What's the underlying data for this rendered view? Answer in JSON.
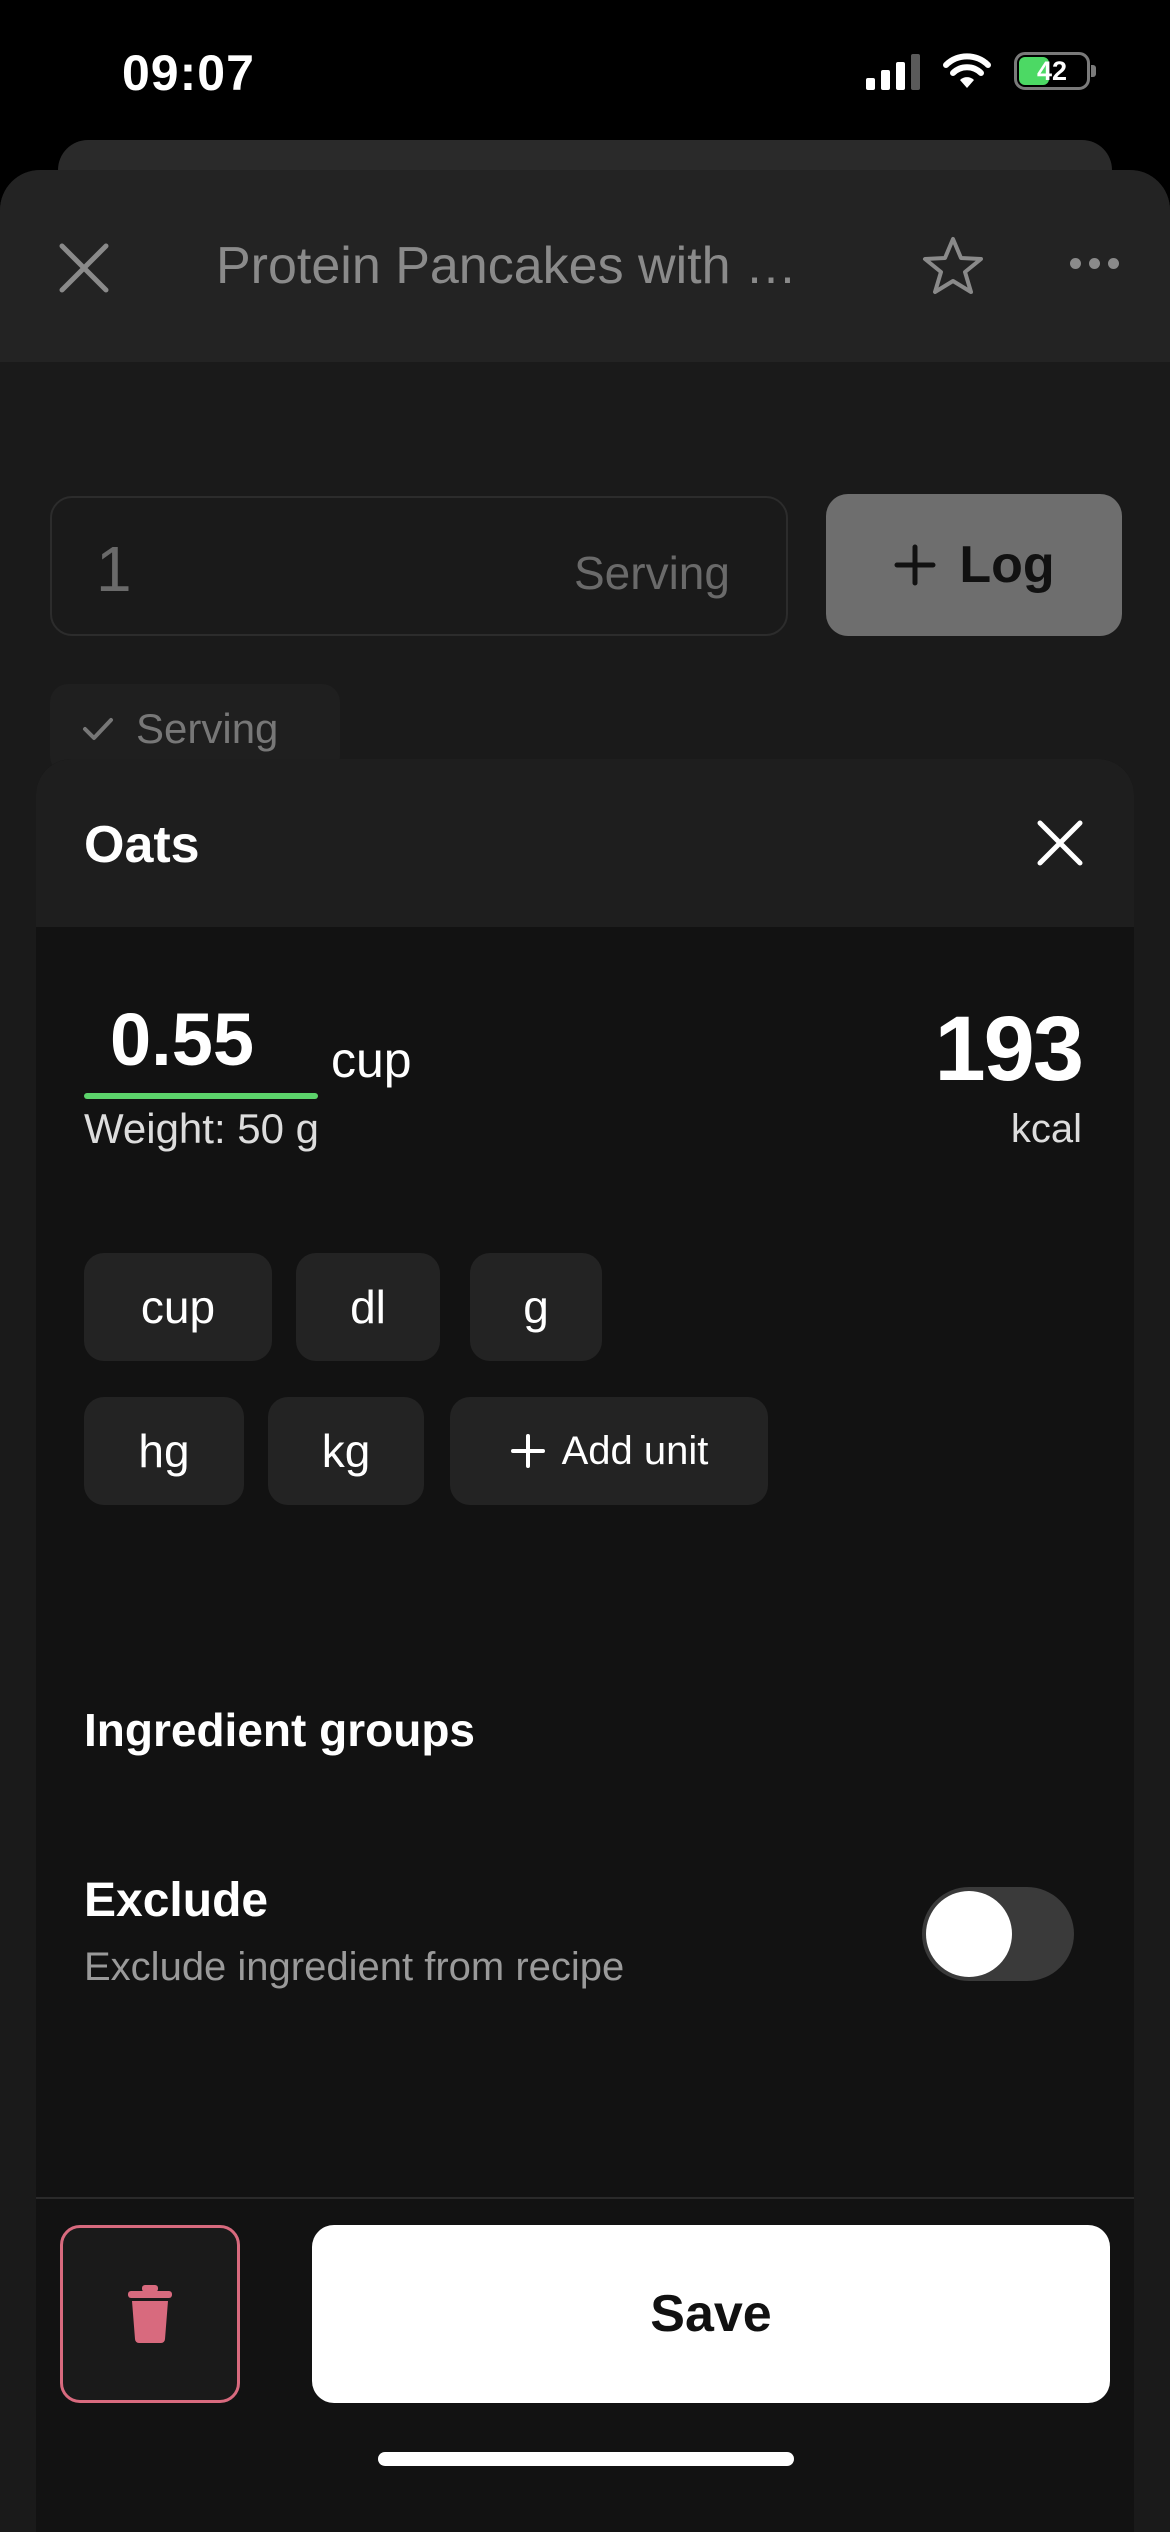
{
  "status_bar": {
    "time": "09:07",
    "battery": "42"
  },
  "background": {
    "title": "Protein Pancakes with …",
    "quantity_value": "1",
    "quantity_unit": "Serving",
    "log_label": "Log",
    "serving_chip": "Serving"
  },
  "modal": {
    "title": "Oats",
    "amount": "0.55",
    "unit": "cup",
    "weight": "Weight: 50 g",
    "kcal_value": "193",
    "kcal_unit": "kcal",
    "units": [
      "cup",
      "dl",
      "g",
      "hg",
      "kg"
    ],
    "add_unit_label": "Add unit",
    "groups_title": "Ingredient groups",
    "exclude_title": "Exclude",
    "exclude_subtitle": "Exclude ingredient from recipe",
    "exclude_enabled": false,
    "save_label": "Save"
  },
  "colors": {
    "accent_green": "#5cd36b",
    "delete_pink": "#d86a7e",
    "battery_green": "#4cd964"
  }
}
